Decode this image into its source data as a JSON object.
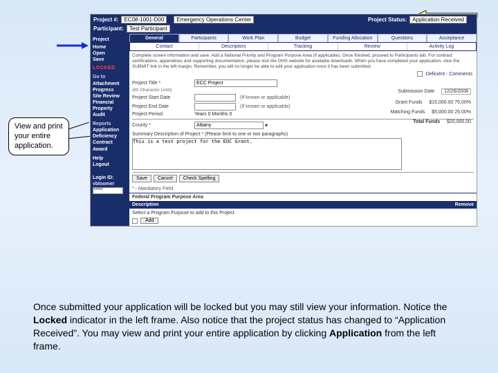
{
  "header": {
    "project_num_label": "Project #:",
    "project_num": "EC08-1001-D00",
    "project_name": "Emergency Operations Center",
    "status_label": "Project Status:",
    "status": "Application Received",
    "participant_label": "Participant:",
    "participant": "Test Participant"
  },
  "sidebar": {
    "project": "Project",
    "items1": [
      "Home",
      "Open",
      "Save"
    ],
    "locked": "LOCKED",
    "goto": "Go to",
    "items2": [
      "Attachment",
      "Progress",
      "Site Review",
      "Financial",
      "Property",
      "Audit"
    ],
    "reports": "Reports",
    "items3": [
      "Application",
      "Deficiency",
      "Contract",
      "Award"
    ],
    "help": "Help",
    "logout": "Logout",
    "login_label": "Login ID:",
    "login_id": "vbloomer",
    "placeholder": "*****"
  },
  "tabs": [
    "General",
    "Participants",
    "Work Plan",
    "Budget",
    "Funding Allocation",
    "Questions",
    "Acceptance"
  ],
  "subtabs": [
    "Contact",
    "Descriptors",
    "Tracking",
    "Review",
    "Activity Log"
  ],
  "blurb": "Complete screen information and save. Add a National Priority and Program Purpose Area (if applicable). Once finished, proceed to Participants tab. For contract certifications, appendices and supporting documentation, please visit the OHS website for available downloads. When you have completed your application, click the SUBMIT link in the left margin. Remember, you will no longer be able to edit your application once it has been submitted.",
  "deficient": "Deficient - Comments",
  "form": {
    "title_label": "Project Title *",
    "title_hint": "(80 Character Limit)",
    "title_value": "ECC Project",
    "start_label": "Project Start Date",
    "end_label": "Project End Date",
    "known_hint": "(If known or applicable)",
    "period_label": "Project Period",
    "period_value": "Years  0  Months  0",
    "county_label": "County *",
    "county_value": "Albany",
    "summary_label": "Summary Description of Project * (Please limit to one or two paragraphs)",
    "summary_value": "This is a test project for the EOC Grant.",
    "sub_date_label": "Submission Date",
    "sub_date": "12/26/2008",
    "grant_label": "Grant Funds",
    "grant_value": "$15,000.00  75.00%",
    "match_label": "Matching Funds",
    "match_value": "$5,000.00  25.00%",
    "total_label": "Total Funds",
    "total_value": "$20,000.00"
  },
  "buttons": {
    "save": "Save",
    "cancel": "Cancel",
    "spell": "Check Spelling"
  },
  "mandatory": "* - Mandatory Field",
  "fppa": "Federal Program Purpose Area",
  "table": {
    "desc": "Description",
    "remove": "Remove"
  },
  "selectrow": {
    "text": "Select a Program Purpose to add to this Project.",
    "add": "Add"
  },
  "callout1": "View and print your entire application.",
  "bodytext": {
    "t1": "Once submitted your application will be locked but you may still view your information.  Notice the ",
    "t2": "Locked",
    "t3": " indicator in the left frame.  Also notice that the project status has changed to “Application Received”.  You may view and print your entire application by clicking ",
    "t4": "Application",
    "t5": " from the left frame."
  }
}
